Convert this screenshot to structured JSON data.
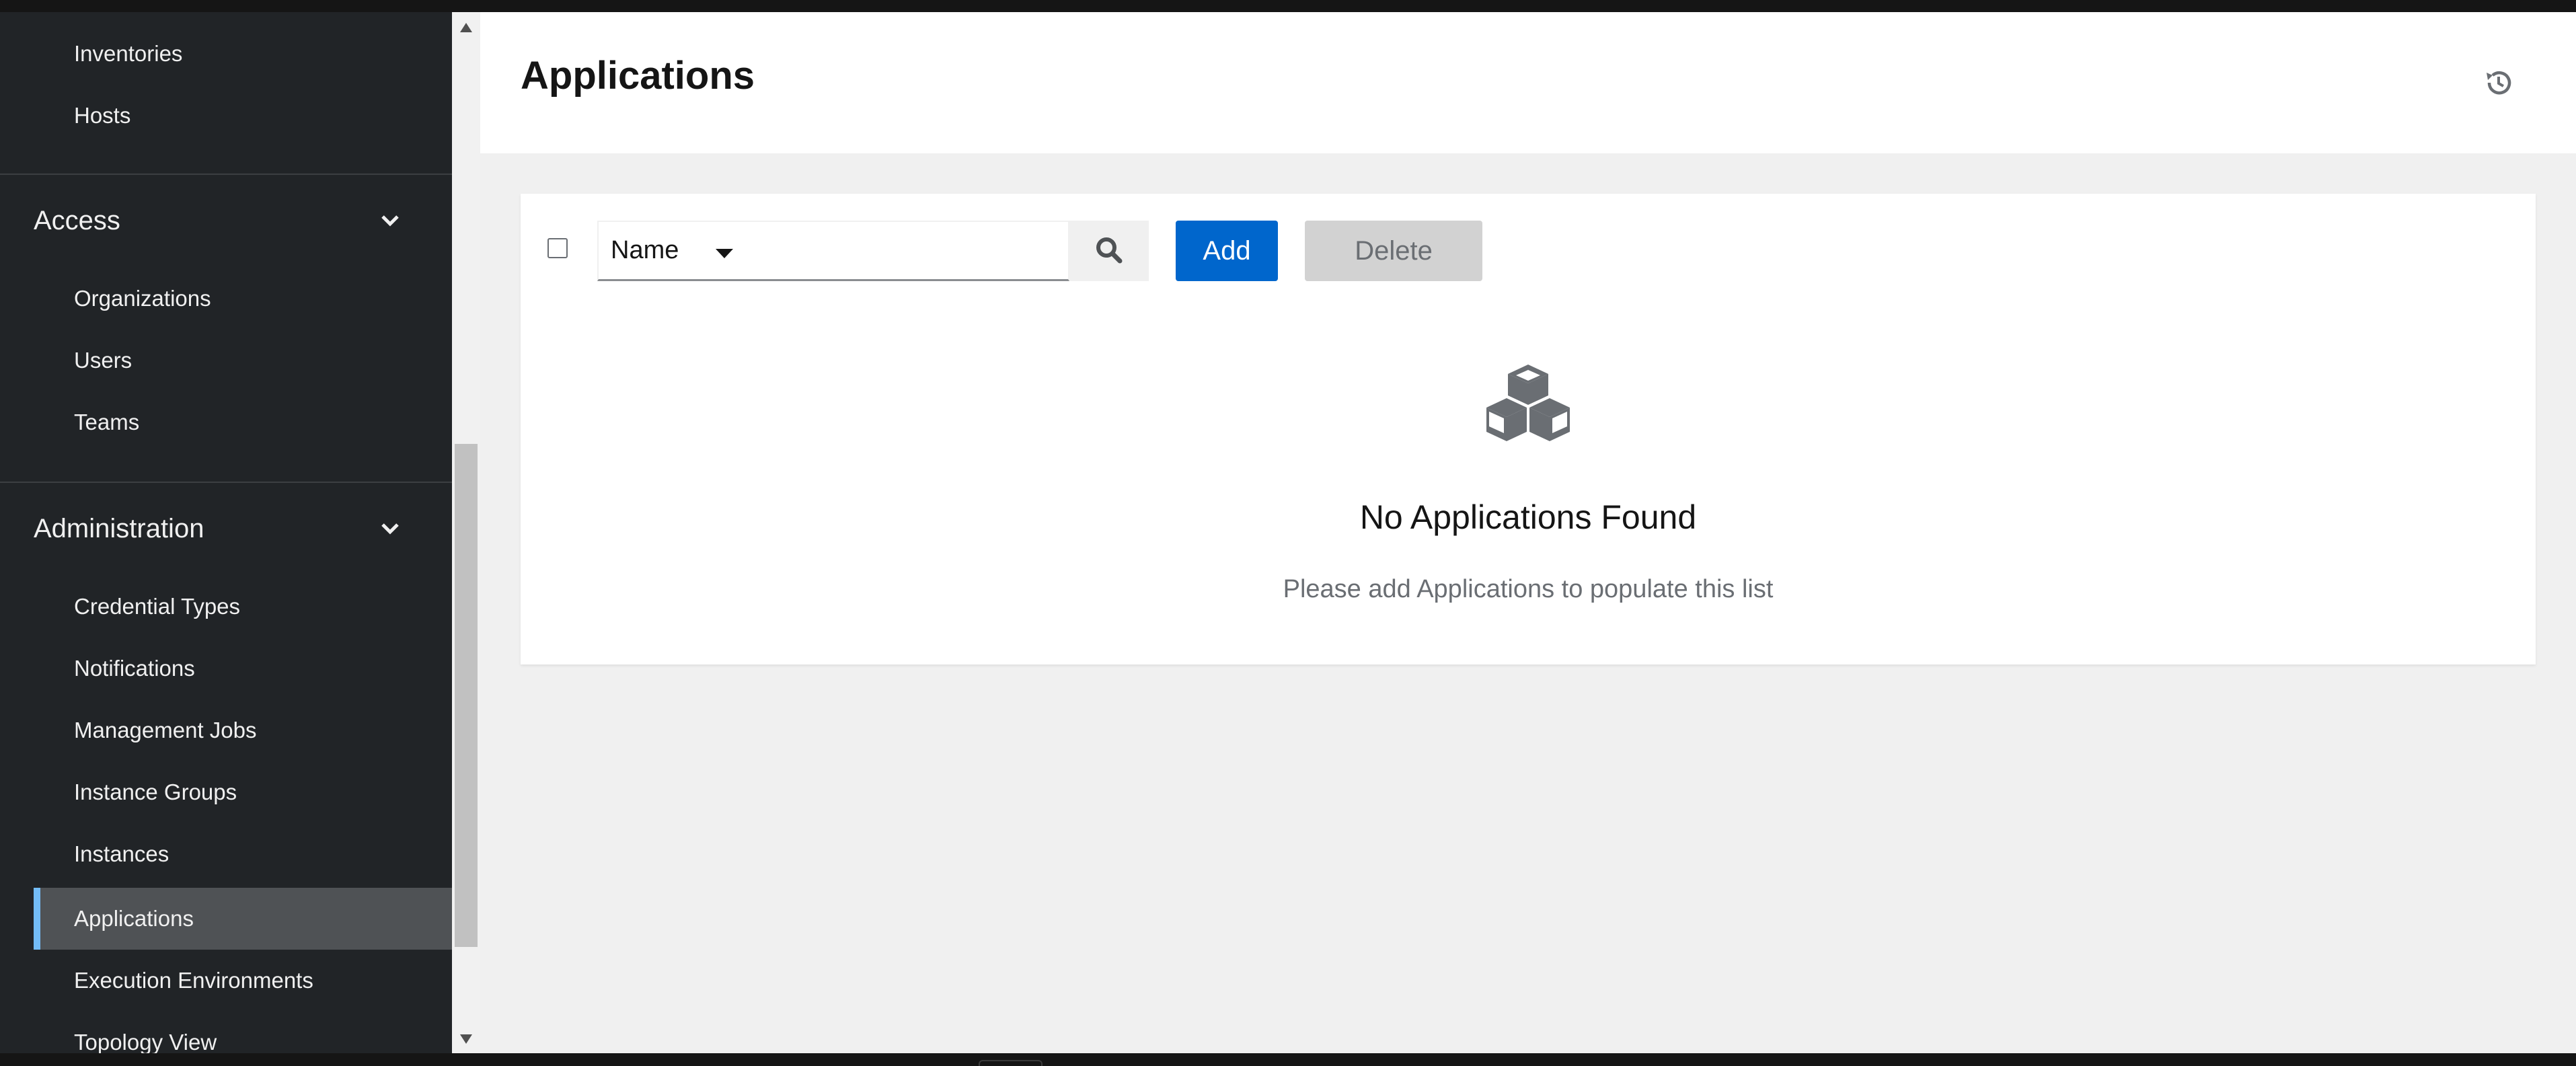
{
  "sidebar": {
    "top_items": [
      {
        "label": "Inventories"
      },
      {
        "label": "Hosts"
      }
    ],
    "groups": [
      {
        "title": "Access",
        "items": [
          {
            "label": "Organizations"
          },
          {
            "label": "Users"
          },
          {
            "label": "Teams"
          }
        ]
      },
      {
        "title": "Administration",
        "items": [
          {
            "label": "Credential Types"
          },
          {
            "label": "Notifications"
          },
          {
            "label": "Management Jobs"
          },
          {
            "label": "Instance Groups"
          },
          {
            "label": "Instances"
          },
          {
            "label": "Applications",
            "active": true
          },
          {
            "label": "Execution Environments"
          },
          {
            "label": "Topology View"
          }
        ]
      }
    ],
    "accent_color": "#73bcf7"
  },
  "header": {
    "title": "Applications",
    "history_icon": "history-icon"
  },
  "toolbar": {
    "filter_select_value": "Name",
    "search_value": "",
    "search_icon": "search-icon",
    "add_label": "Add",
    "delete_label": "Delete",
    "add_color": "#0066cc"
  },
  "empty_state": {
    "icon": "cubes-icon",
    "title": "No Applications Found",
    "body": "Please add Applications to populate this list"
  }
}
